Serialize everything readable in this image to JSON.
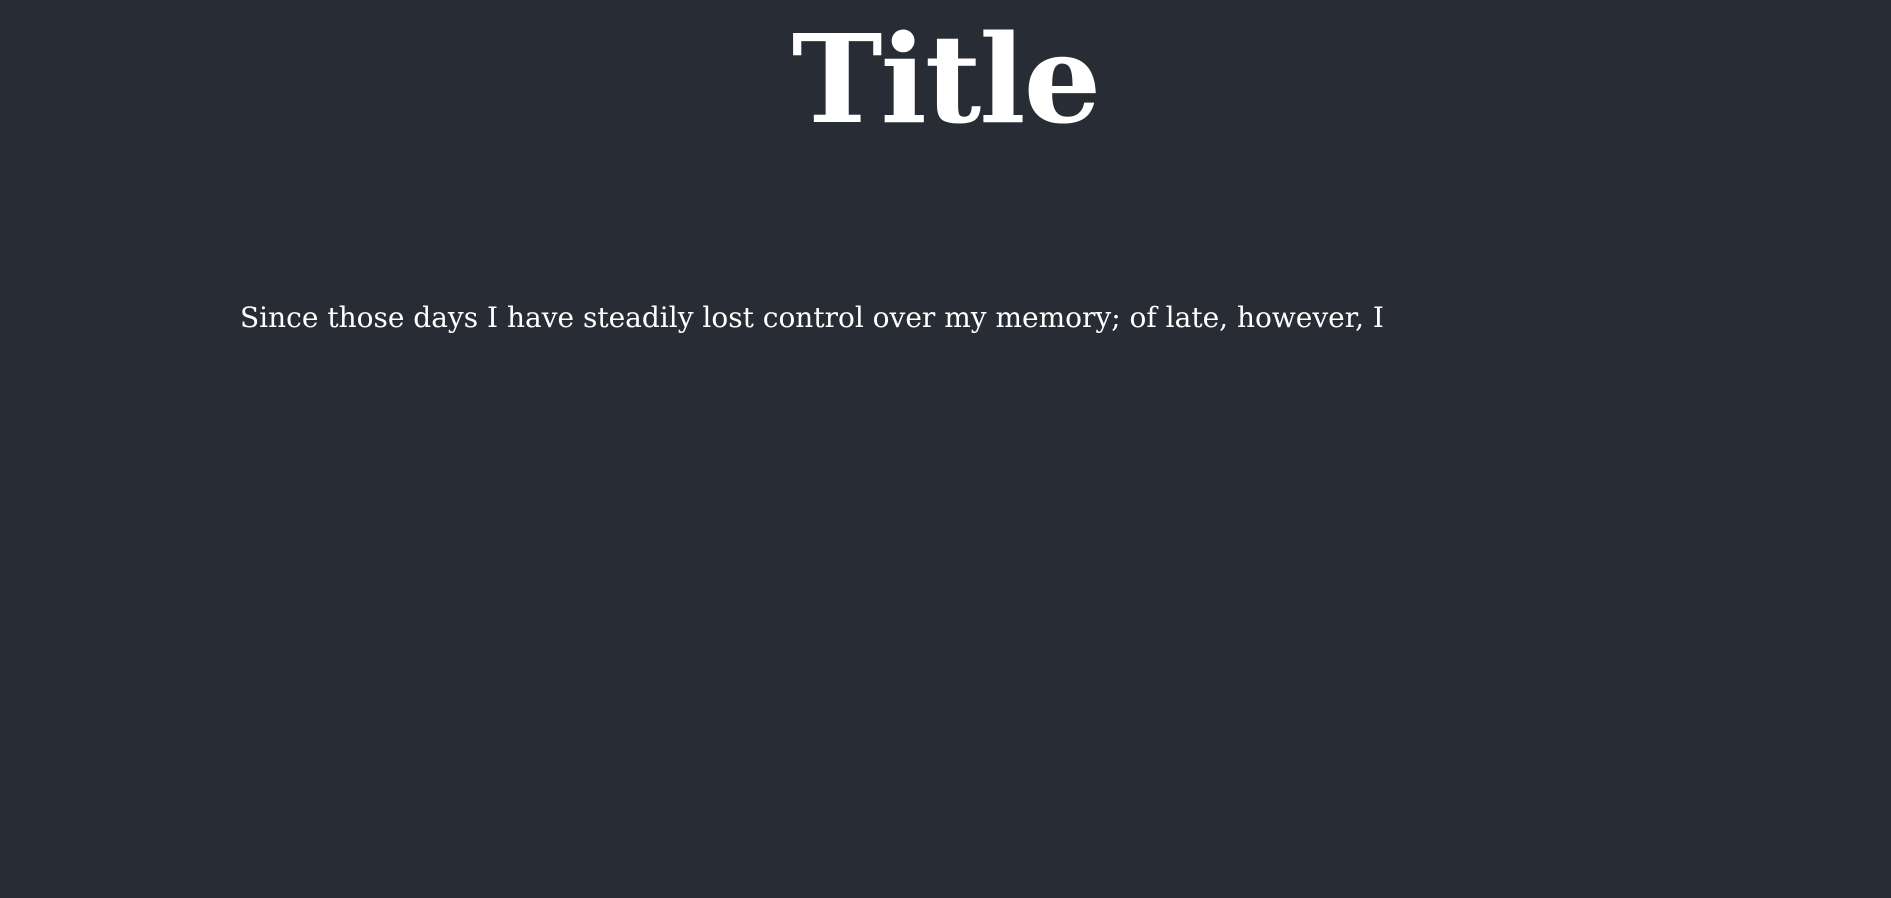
{
  "page": {
    "title": "Title",
    "paragraph": "Since those days I have steadily lost control over my memory; of late, however, I"
  },
  "colors": {
    "background": "#282c35",
    "text": "#ffffff"
  }
}
